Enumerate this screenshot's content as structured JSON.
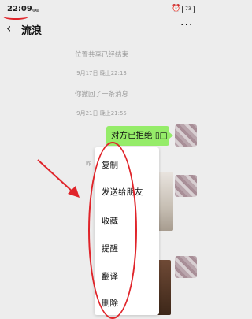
{
  "status_bar": {
    "time": "22:09",
    "signal": "๏๏",
    "battery": "73",
    "alarm": "⏰"
  },
  "header": {
    "back": "‹",
    "title": "流浪",
    "more": "···"
  },
  "messages": {
    "location_ended": "位置共享已经结束",
    "time_1": "9月17日 晚上22:13",
    "recalled": "你撤回了一条消息",
    "time_2": "9月21日 晚上21:55",
    "bubble_text": "对方已拒绝 ▯□",
    "partial_left": "昨"
  },
  "context_menu": {
    "items": [
      "复制",
      "发送给朋友",
      "收藏",
      "提醒",
      "翻译",
      "删除"
    ]
  },
  "colors": {
    "accent_red": "#e0242a",
    "bubble_green": "#95ec69",
    "background": "#ededed"
  },
  "icons": [
    "back-icon",
    "more-icon",
    "alarm-icon",
    "battery-icon",
    "signal-icon"
  ]
}
